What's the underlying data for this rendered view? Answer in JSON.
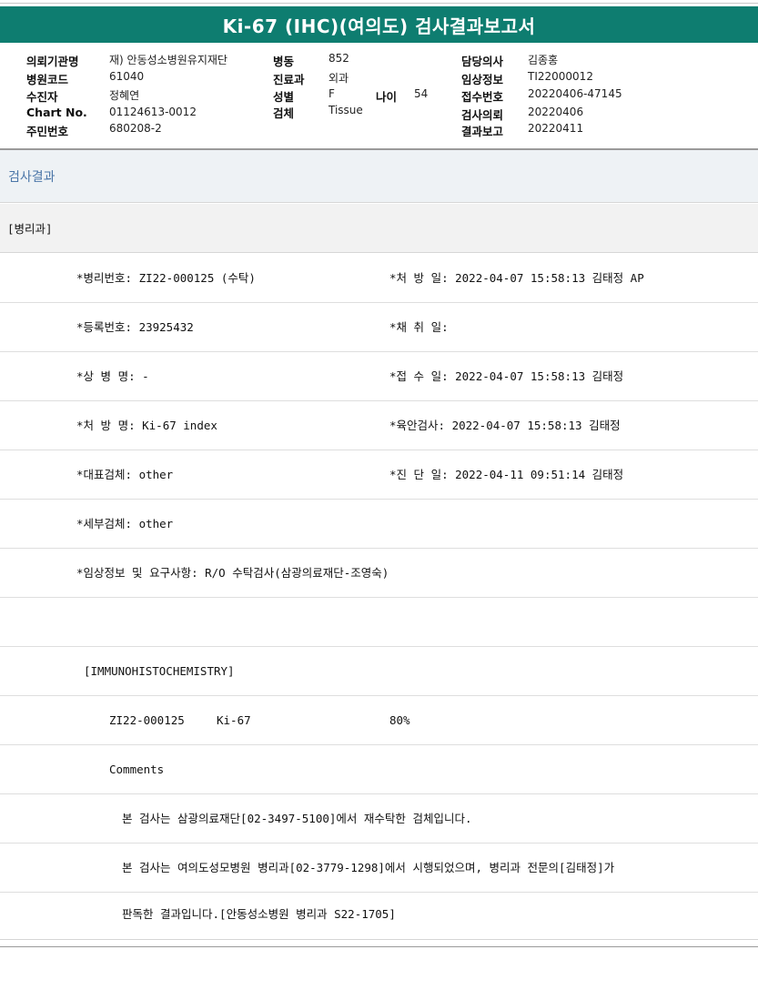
{
  "report": {
    "title": "Ki-67 (IHC)(여의도) 검사결과보고서"
  },
  "info": {
    "institution_label": "의뢰기관명",
    "institution": "재) 안동성소병원유지재단",
    "hospital_code_label": "병원코드",
    "hospital_code": "61040",
    "recipient_label": "수진자",
    "recipient": "정혜연",
    "chart_no_label": "Chart No.",
    "chart_no": "01124613-0012",
    "resident_no_label": "주민번호",
    "resident_no": "680208-2",
    "ward_label": "병동",
    "ward": "852",
    "department_label": "진료과",
    "department": "외과",
    "sex_label": "성별",
    "sex": "F",
    "age_label": "나이",
    "age": "54",
    "specimen_label": "검체",
    "specimen": "Tissue",
    "doctor_label": "담당의사",
    "doctor": "김종홍",
    "clinical_label": "임상정보",
    "clinical": "TI22000012",
    "receipt_no_label": "접수번호",
    "receipt_no": "20220406-47145",
    "request_label": "검사의뢰",
    "request_date": "20220406",
    "result_label": "결과보고",
    "result_date": "20220411"
  },
  "section_title": "검사결과",
  "dept_label": "[병리과]",
  "fields": {
    "pathology_no": "*병리번호: ZI22-000125 (수탁)",
    "prescribed": "*처 방 일: 2022-04-07 15:58:13  김태정 AP",
    "registration_no": "*등록번호: 23925432",
    "collected": "*채 취 일:",
    "disease_name": "*상 병 명: -",
    "received": "*접 수 일: 2022-04-07 15:58:13  김태정",
    "order_name": "*처 방 명: Ki-67 index",
    "gross_exam": "*육안검사: 2022-04-07 15:58:13  김태정",
    "main_specimen": "*대표검체: other",
    "diagnosed": "*진 단 일: 2022-04-11 09:51:14  김태정",
    "sub_specimen": "*세부검체: other",
    "clinical_info": "*임상정보 및 요구사항: R/O 수탁검사(삼광의료재단-조영숙)"
  },
  "ihc": {
    "heading": "[IMMUNOHISTOCHEMISTRY]",
    "case_no": "ZI22-000125",
    "marker": "Ki-67",
    "result": "80%",
    "comments_label": "Comments",
    "comment1": "본 검사는 삼광의료재단[02-3497-5100]에서 재수탁한 검체입니다.",
    "comment2": "본 검사는 여의도성모병원 병리과[02-3779-1298]에서 시행되었으며, 병리과 전문의[김태정]가",
    "comment3": "판독한 결과입니다.[안동성소병원 병리과 S22-1705]"
  }
}
